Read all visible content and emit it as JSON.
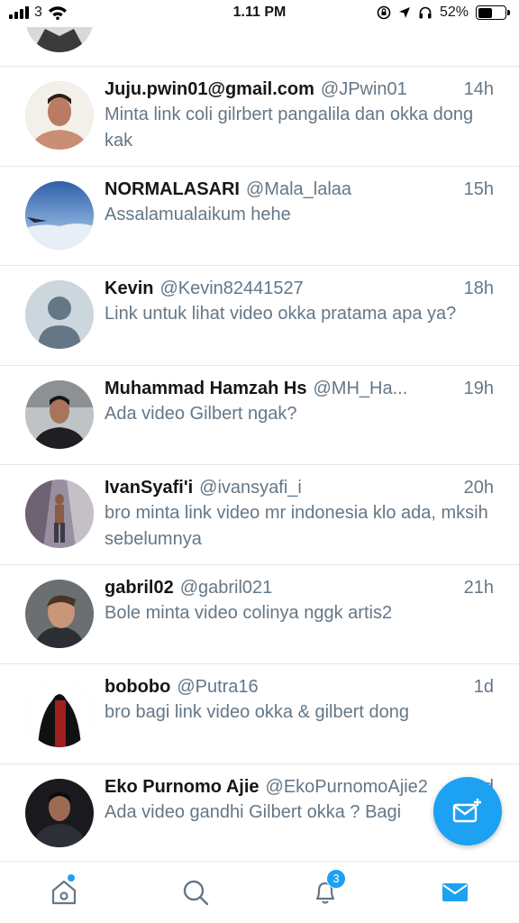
{
  "status_bar": {
    "carrier": "3",
    "time": "1.11 PM",
    "battery": "52%",
    "battery_level": 0.52
  },
  "messages": [
    {
      "name": "Juju.pwin01@gmail.com",
      "handle": "@JPwin01",
      "time": "14h",
      "text": "Minta link coli gilrbert pangalila dan okka dong kak"
    },
    {
      "name": "NORMALASARI",
      "handle": "@Mala_lalaa",
      "time": "15h",
      "text": "Assalamualaikum hehe"
    },
    {
      "name": "Kevin",
      "handle": "@Kevin82441527",
      "time": "18h",
      "text": "Link untuk lihat video okka pratama apa ya?"
    },
    {
      "name": "Muhammad Hamzah Hs",
      "handle": "@MH_Ha...",
      "time": "19h",
      "text": "Ada video Gilbert ngak?"
    },
    {
      "name": "IvanSyafi'i",
      "handle": "@ivansyafi_i",
      "time": "20h",
      "text": "bro minta link video mr indonesia klo ada, mksih sebelumnya"
    },
    {
      "name": "gabril02",
      "handle": "@gabril021",
      "time": "21h",
      "text": "Bole minta video colinya nggk artis2"
    },
    {
      "name": "bobobo",
      "handle": "@Putra16",
      "time": "1d",
      "text": "bro bagi link video okka & gilbert dong"
    },
    {
      "name": "Eko Purnomo Ajie",
      "handle": "@EkoPurnomoAjie2",
      "time": "1d",
      "text": "Ada video gandhi Gilbert okka ? Bagi"
    }
  ],
  "tab_bar": {
    "notifications_badge": "3",
    "active_tab": "messages"
  },
  "colors": {
    "accent": "#1da1f2",
    "secondary_text": "#657786",
    "primary_text": "#14171a",
    "divider": "#e1e8ed"
  },
  "icons": {
    "home": "home-icon",
    "search": "search-icon",
    "notifications": "bell-icon",
    "messages": "envelope-icon",
    "compose": "compose-message-icon"
  }
}
